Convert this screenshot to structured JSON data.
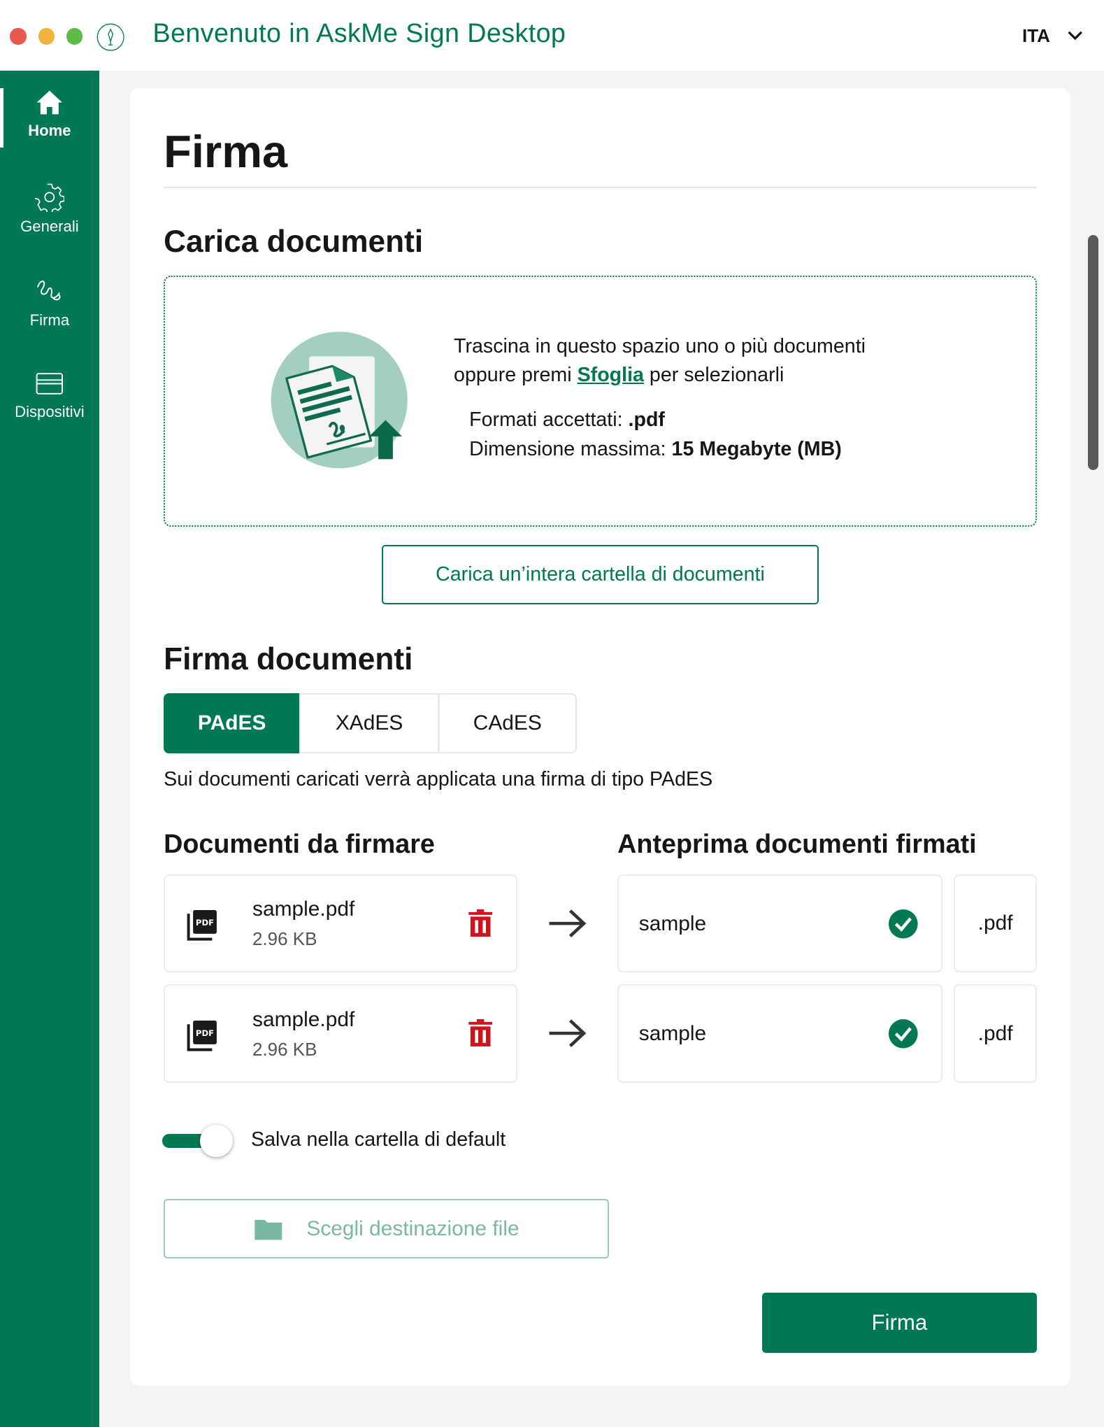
{
  "window": {
    "title": "Benvenuto in AskMe Sign Desktop",
    "language": "ITA"
  },
  "sidebar": {
    "items": [
      {
        "label": "Home",
        "active": true
      },
      {
        "label": "Generali"
      },
      {
        "label": "Firma"
      },
      {
        "label": "Dispositivi"
      }
    ]
  },
  "page": {
    "title": "Firma"
  },
  "upload": {
    "heading": "Carica documenti",
    "line1": "Trascina in questo spazio uno o più documenti",
    "line2_prefix": "oppure premi ",
    "browse_link": "Sfoglia",
    "line2_suffix": " per selezionarli",
    "formats_label": "Formati accettati: ",
    "formats_value": ".pdf",
    "maxsize_label": "Dimensione massima: ",
    "maxsize_value": "15 Megabyte (MB)",
    "folder_button": "Carica un’intera cartella di documenti"
  },
  "sign": {
    "heading": "Firma documenti",
    "tabs": [
      {
        "label": "PAdES",
        "selected": true
      },
      {
        "label": "XAdES"
      },
      {
        "label": "CAdES"
      }
    ],
    "description": "Sui documenti caricati verrà applicata una firma di tipo PAdES",
    "docs_heading": "Documenti da firmare",
    "preview_heading": "Anteprima documenti firmati",
    "files": [
      {
        "name": "sample.pdf",
        "size": "2.96 KB",
        "output_name": "sample",
        "output_ext": ".pdf"
      },
      {
        "name": "sample.pdf",
        "size": "2.96 KB",
        "output_name": "sample",
        "output_ext": ".pdf"
      }
    ],
    "default_folder_toggle": {
      "label": "Salva nella cartella di default",
      "on": true
    },
    "destination_button": "Scegli destinazione file",
    "submit": "Firma"
  },
  "colors": {
    "brand": "#007853",
    "danger": "#d0141c"
  }
}
